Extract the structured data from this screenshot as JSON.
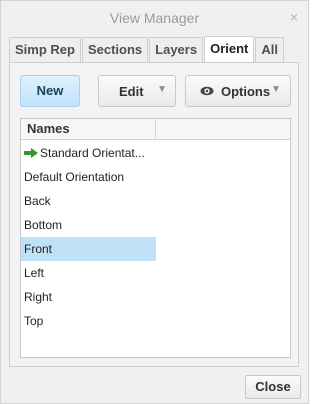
{
  "window": {
    "title": "View Manager",
    "close_glyph": "×"
  },
  "tabs": [
    {
      "label": "Simp Rep",
      "active": false
    },
    {
      "label": "Sections",
      "active": false
    },
    {
      "label": "Layers",
      "active": false
    },
    {
      "label": "Orient",
      "active": true
    },
    {
      "label": "All",
      "active": false
    }
  ],
  "toolbar": {
    "new_label": "New",
    "edit_label": "Edit",
    "options_label": "Options",
    "options_icon": "eye-icon",
    "dropdown_icon": "caret-down-icon"
  },
  "list": {
    "column_header": "Names",
    "items": [
      {
        "label": "Standard Orientat...",
        "icon": "green-arrow-icon",
        "selected": false
      },
      {
        "label": "Default Orientation",
        "selected": false
      },
      {
        "label": "Back",
        "selected": false
      },
      {
        "label": "Bottom",
        "selected": false
      },
      {
        "label": "Front",
        "selected": true
      },
      {
        "label": "Left",
        "selected": false
      },
      {
        "label": "Right",
        "selected": false
      },
      {
        "label": "Top",
        "selected": false
      }
    ]
  },
  "footer": {
    "close_label": "Close"
  },
  "colors": {
    "accent_selected": "#bfe1f7",
    "new_button": "#cfeafb",
    "arrow_green": "#2e9b2e"
  }
}
